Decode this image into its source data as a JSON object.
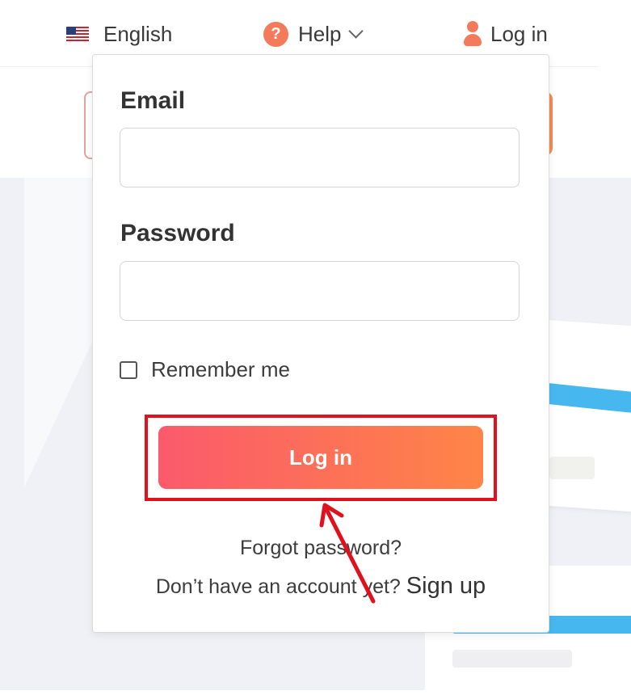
{
  "topbar": {
    "language": "English",
    "help": "Help",
    "login": "Log in"
  },
  "login_form": {
    "email_label": "Email",
    "email_value": "",
    "password_label": "Password",
    "password_value": "",
    "remember_label": "Remember me",
    "remember_checked": false,
    "submit_label": "Log in",
    "forgot_password": "Forgot password?",
    "signup_prompt": "Don’t have an account yet?",
    "signup_link": "Sign up"
  },
  "colors": {
    "accent_start": "#fb5a6b",
    "accent_end": "#fe8547",
    "annotation": "#e0101d",
    "highlight_blue": "#47b8ef"
  },
  "icons": [
    "us-flag-icon",
    "help-icon",
    "chevron-down-icon",
    "user-icon",
    "arrow-annotation"
  ]
}
